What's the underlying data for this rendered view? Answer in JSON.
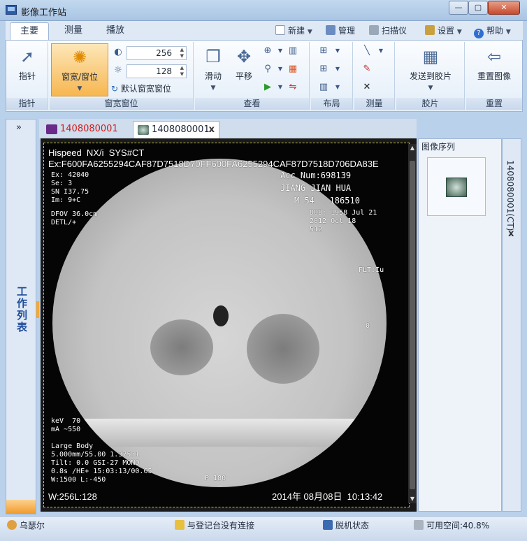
{
  "window": {
    "title": "影像工作站",
    "minimize": "—",
    "maximize": "▢",
    "close": "✕"
  },
  "ribbon_tabs": [
    "主要",
    "测量",
    "播放"
  ],
  "quick": {
    "new": "新建",
    "manage": "管理",
    "scanner": "扫描仪",
    "settings": "设置",
    "help": "帮助"
  },
  "groups": {
    "pointer": {
      "button": "指针",
      "label": "指针"
    },
    "window": {
      "button": "窗宽/窗位",
      "width": "256",
      "level": "128",
      "default_btn": "默认窗宽窗位",
      "label": "窗宽窗位"
    },
    "view": {
      "scroll": "滑动",
      "pan": "平移",
      "label": "查看"
    },
    "layout": {
      "label": "布局"
    },
    "measure": {
      "label": "测量"
    },
    "film": {
      "button": "发送到胶片",
      "label": "胶片"
    },
    "reset": {
      "button": "重置图像",
      "label": "重置"
    }
  },
  "sidebar": {
    "expand": "»",
    "label": "工作列表"
  },
  "doc_tabs": [
    {
      "label": "1408080001",
      "color": "#d21c1c"
    },
    {
      "label": "1408080001",
      "close": "x"
    }
  ],
  "overlay": {
    "top_left": "Hispeed  NX/i  SYS#CT",
    "uid_line": "Ex:F600FA6255294CAF87D7518D70FF600FA6255294CAF87D7518D706DA83E",
    "exam": "Ex: 42040\nSe: 3\nSN I37.75\nIm: 9+C",
    "dfov": "DFOV 36.0cm\nDETL/+",
    "acc": "Acc Num:698139",
    "name": "JIANG JIAN HUA",
    "sex_age": "M 54   186510",
    "dob": "DOB: 1958 Jul 21\n2012 Oct 18\n512",
    "flt": "FLT:Iu",
    "zero": "0",
    "kev": "keV  70\nmA ~550",
    "recon": "Large Body\n5.000mm/55.00 1.375:1\nTilt: 0.0 GSI-27 MONO\n0.8s /HE+ 15:03:13/00.65\nW:1500 L:-450",
    "p180": "P 180",
    "wl": "W:256L:128",
    "datetime": "2014年 08月08日  10:13:42"
  },
  "right_panel": {
    "title": "图像序列",
    "vertical_tab": "1408080001(CT)",
    "close": "x"
  },
  "status": {
    "user": "乌瑟尔",
    "connection": "与登记台没有连接",
    "offline": "脱机状态",
    "space": "可用空间:40.8%"
  },
  "colors": {
    "accent": "#f29b2a",
    "ribbon_bg": "#e3edf8",
    "frame": "#b9d1ea"
  }
}
